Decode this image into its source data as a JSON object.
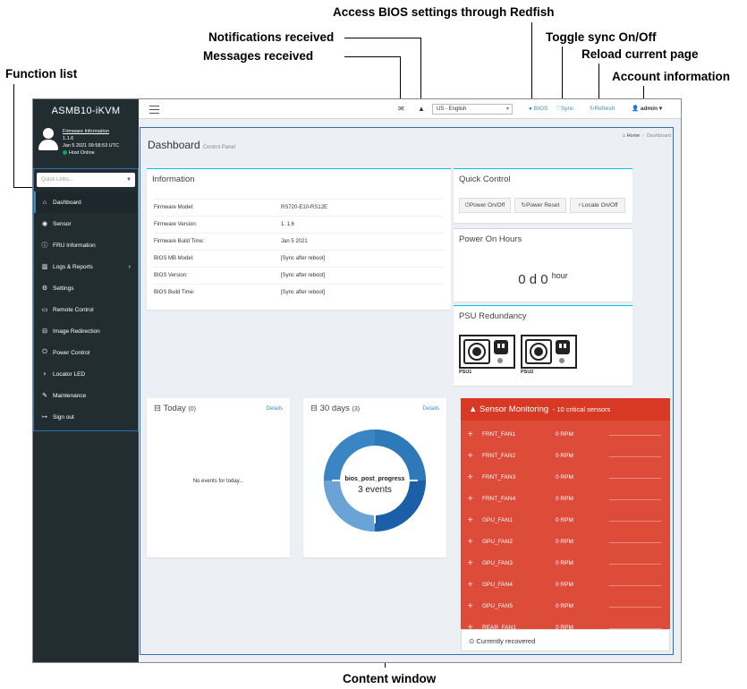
{
  "annotations": {
    "bios": "Access BIOS settings through Redfish",
    "notifications": "Notifications received",
    "messages": "Messages received",
    "sync": "Toggle sync On/Off",
    "reload": "Reload current page",
    "function_list": "Function list",
    "account": "Account information",
    "content_window": "Content window"
  },
  "sidebar": {
    "brand": "ASMB10-iKVM",
    "firmware_link": "Firmware Information",
    "firmware_version": "1.1.6",
    "datetime": "Jan 5 2021 09:58:53 UTC",
    "status": "Host Online",
    "quick_links_placeholder": "Quick Links...",
    "items": [
      {
        "label": "Dashboard",
        "icon": "home-icon"
      },
      {
        "label": "Sensor",
        "icon": "dashboard-icon"
      },
      {
        "label": "FRU Information",
        "icon": "info-icon"
      },
      {
        "label": "Logs & Reports",
        "icon": "bar-chart-icon"
      },
      {
        "label": "Settings",
        "icon": "gear-icon"
      },
      {
        "label": "Remote Control",
        "icon": "monitor-icon"
      },
      {
        "label": "Image Redirection",
        "icon": "disk-icon"
      },
      {
        "label": "Power Control",
        "icon": "power-icon"
      },
      {
        "label": "Locator LED",
        "icon": "lightbulb-icon"
      },
      {
        "label": "Maintenance",
        "icon": "wrench-icon"
      },
      {
        "label": "Sign out",
        "icon": "sign-out-icon"
      }
    ]
  },
  "topbar": {
    "language": "US - English",
    "bios": "BIOS",
    "sync": "Sync",
    "refresh": "Refresh",
    "account": "admin"
  },
  "page": {
    "title": "Dashboard",
    "subtitle": "Control Panel",
    "breadcrumb_home": "Home",
    "breadcrumb_current": "Dashboard"
  },
  "information": {
    "title": "Information",
    "rows": [
      {
        "label": "Firmware Model:",
        "value": "RS720-E10-RS12E"
      },
      {
        "label": "Firmware Version:",
        "value": "1. 1.6"
      },
      {
        "label": "Firmware Build Time:",
        "value": "Jan 5 2021"
      },
      {
        "label": "BIOS MB Model:",
        "value": "[Sync after reboot]"
      },
      {
        "label": "BIOS Version:",
        "value": "[Sync after reboot]"
      },
      {
        "label": "BIOS Build Time:",
        "value": "[Sync after reboot]"
      }
    ]
  },
  "quick_control": {
    "title": "Quick Control",
    "buttons": [
      "Power On/Off",
      "Power Reset",
      "Locate On/Off"
    ]
  },
  "power_on_hours": {
    "title": "Power On Hours",
    "value": "0 d 0",
    "unit": "hour"
  },
  "psu": {
    "title": "PSU Redundancy",
    "units": [
      "PSU1",
      "PSU2"
    ]
  },
  "today": {
    "title": "Today",
    "count": "(0)",
    "details": "Details",
    "empty": "No events for today..."
  },
  "days30": {
    "title": "30 days",
    "count": "(3)",
    "details": "Details",
    "center_label": "bios_post_progress",
    "center_value": "3 events"
  },
  "sensor_monitoring": {
    "title": "Sensor Monitoring",
    "subtitle": "- 10 critical sensors",
    "rows": [
      {
        "name": "FRNT_FAN1",
        "value": "0 RPM"
      },
      {
        "name": "FRNT_FAN2",
        "value": "0 RPM"
      },
      {
        "name": "FRNT_FAN3",
        "value": "0 RPM"
      },
      {
        "name": "FRNT_FAN4",
        "value": "0 RPM"
      },
      {
        "name": "GPU_FAN1",
        "value": "0 RPM"
      },
      {
        "name": "GPU_FAN2",
        "value": "0 RPM"
      },
      {
        "name": "GPU_FAN3",
        "value": "0 RPM"
      },
      {
        "name": "GPU_FAN4",
        "value": "0 RPM"
      },
      {
        "name": "GPU_FAN5",
        "value": "0 RPM"
      },
      {
        "name": "REAR_FAN1",
        "value": "0 RPM"
      }
    ],
    "footer": "Currently recovered"
  },
  "colors": {
    "sidebar": "#222d32",
    "accent": "#3c8dbc",
    "danger": "#dd4b39",
    "online": "#00a65a"
  }
}
